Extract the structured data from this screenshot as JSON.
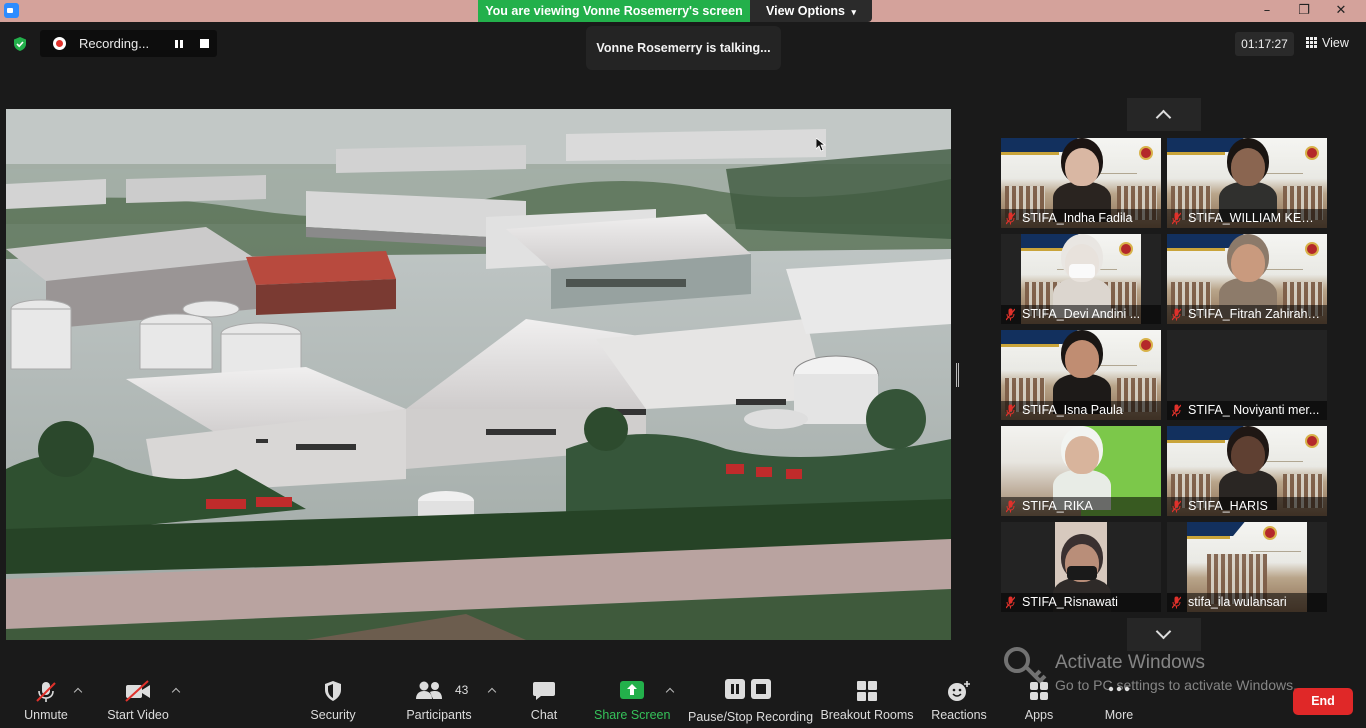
{
  "banner": {
    "viewing": "You are viewing Vonne Rosemerry's screen",
    "view_options": "View Options"
  },
  "window_controls": [
    "–",
    "❐",
    "✕"
  ],
  "recording": {
    "label": "Recording..."
  },
  "talking": "Vonne Rosemerry is talking...",
  "timer": "01:17:27",
  "view_button": "View",
  "colors": {
    "banner_green": "#23b04b",
    "share_green": "#35c25a",
    "end_red": "#e02828",
    "titlebar": "#d4a29b",
    "mic_muted": "#e0312b"
  },
  "gallery": {
    "tiles": [
      {
        "name": "STIFA_Indha Fadila",
        "video": "banner-person",
        "skin": "#d9b7a3",
        "hair": "#1b1412",
        "shirt": "#2a2420"
      },
      {
        "name": "STIFA_WILLIAM KEVIN...",
        "video": "banner-person",
        "skin": "#8a6550",
        "hair": "#1a1512",
        "shirt": "#30302e"
      },
      {
        "name": "STIFA_Devi Andini ...",
        "video": "banner-person-mask",
        "skin": "#e8e2dc",
        "hair": "#e9e6e2",
        "shirt": "#dcd6cf"
      },
      {
        "name": "STIFA_Fitrah Zahirah.K...",
        "video": "banner-person",
        "skin": "#c99a7e",
        "hair": "#8c7a6a",
        "shirt": "#8d7b6a"
      },
      {
        "name": "STIFA_Isna Paula",
        "video": "banner-person",
        "skin": "#c08d72",
        "hair": "#1a1614",
        "shirt": "#1d1a18"
      },
      {
        "name": "STIFA_ Noviyanti mer...",
        "video": "off"
      },
      {
        "name": "STIFA_RIKA",
        "video": "green-person",
        "skin": "#d8b49c",
        "hair": "#f2f4f1",
        "shirt": "#e8ece6"
      },
      {
        "name": "STIFA_HARIS",
        "video": "banner-person",
        "skin": "#5f4032",
        "hair": "#1f1714",
        "shirt": "#2a2623"
      },
      {
        "name": "STIFA_Risnawati",
        "video": "portrait",
        "skin": "#b98e79",
        "hair": "#3a3030",
        "shirt": "#2e2a28"
      },
      {
        "name": "stifa_ila wulansari",
        "video": "banner-only"
      }
    ]
  },
  "toolbar": {
    "unmute": "Unmute",
    "start_video": "Start Video",
    "security": "Security",
    "participants": "Participants",
    "participants_count": "43",
    "chat": "Chat",
    "share_screen": "Share Screen",
    "pause_stop_recording": "Pause/Stop Recording",
    "breakout_rooms": "Breakout Rooms",
    "reactions": "Reactions",
    "apps": "Apps",
    "more": "More",
    "end": "End"
  },
  "watermark": {
    "title": "Activate Windows",
    "subtitle": "Go to PC settings to activate Windows."
  }
}
